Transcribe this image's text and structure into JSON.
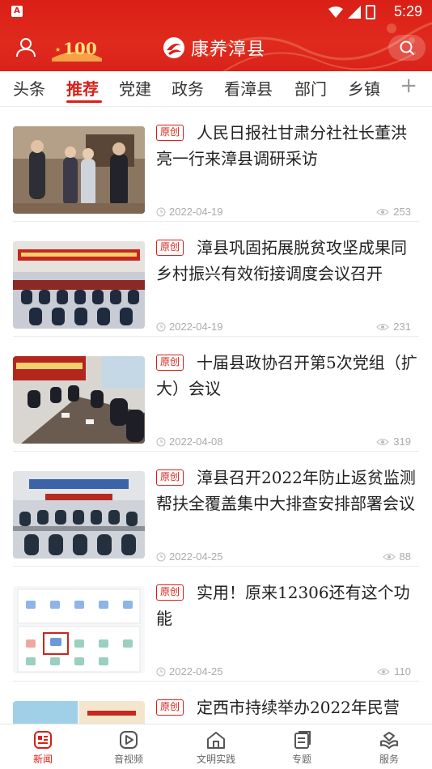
{
  "status_bar": {
    "time": "5:29",
    "battery": "5"
  },
  "header": {
    "app_name": "康养漳县",
    "anniversary_badge": "100"
  },
  "tabs": [
    {
      "label": "头条"
    },
    {
      "label": "推荐"
    },
    {
      "label": "党建"
    },
    {
      "label": "政务"
    },
    {
      "label": "看漳县"
    },
    {
      "label": "部门"
    },
    {
      "label": "乡镇"
    }
  ],
  "active_tab": "推荐",
  "news": [
    {
      "badge": "原创",
      "title": "人民日报社甘肃分社社长董洪亮一行来漳县调研采访",
      "date": "2022-04-19",
      "views": "253"
    },
    {
      "badge": "原创",
      "title": "漳县巩固拓展脱贫攻坚成果同乡村振兴有效衔接调度会议召开",
      "date": "2022-04-19",
      "views": "231"
    },
    {
      "badge": "原创",
      "title": "十届县政协召开第5次党组（扩大）会议",
      "date": "2022-04-08",
      "views": "319"
    },
    {
      "badge": "原创",
      "title": "漳县召开2022年防止返贫监测帮扶全覆盖集中大排查安排部署会议",
      "date": "2022-04-25",
      "views": "88"
    },
    {
      "badge": "原创",
      "title": "实用！原来12306还有这个功能",
      "date": "2022-04-25",
      "views": "110"
    },
    {
      "badge": "原创",
      "title": "定西市持续举办2022年民营",
      "date": "",
      "views": ""
    }
  ],
  "bottom_nav": [
    {
      "label": "新闻",
      "icon": "news-icon",
      "active": true
    },
    {
      "label": "音视频",
      "icon": "video-icon",
      "active": false
    },
    {
      "label": "文明实践",
      "icon": "home-icon",
      "active": false
    },
    {
      "label": "专题",
      "icon": "topic-icon",
      "active": false
    },
    {
      "label": "服务",
      "icon": "service-icon",
      "active": false
    }
  ],
  "colors": {
    "brand_red": "#d91f16",
    "meta_gray": "#aaaaaa"
  }
}
